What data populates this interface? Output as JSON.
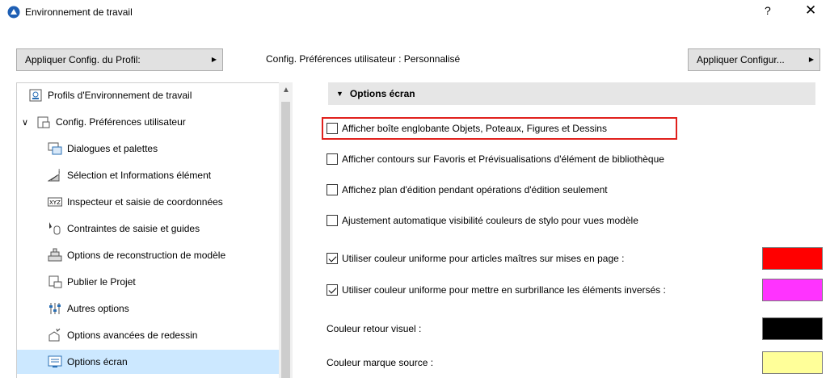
{
  "window": {
    "title": "Environnement de travail",
    "help_label": "?",
    "close_label": "✕"
  },
  "toolbar": {
    "apply_profile_label": "Appliquer Config. du Profil:",
    "config_label": "Config. Préférences utilisateur : Personnalisé",
    "apply_config_label": "Appliquer Configur..."
  },
  "tree": {
    "items": [
      {
        "label": "Profils d'Environnement de travail",
        "icon": "profiles-icon"
      },
      {
        "label": "Config. Préférences utilisateur",
        "icon": "user-prefs-icon",
        "expander": "∨"
      },
      {
        "label": "Dialogues et palettes",
        "icon": "dialogs-icon"
      },
      {
        "label": "Sélection et Informations élément",
        "icon": "selection-info-icon"
      },
      {
        "label": "Inspecteur et saisie de coordonnées",
        "icon": "xyz-icon",
        "icon_text": "XYZ"
      },
      {
        "label": "Contraintes de saisie et guides",
        "icon": "cursor-guide-icon"
      },
      {
        "label": "Options de reconstruction de modèle",
        "icon": "rebuild-icon"
      },
      {
        "label": "Publier le Projet",
        "icon": "publish-icon"
      },
      {
        "label": "Autres options",
        "icon": "sliders-icon"
      },
      {
        "label": "Options avancées de redessin",
        "icon": "redraw-icon"
      },
      {
        "label": "Options écran",
        "icon": "screen-icon",
        "selected": true
      }
    ]
  },
  "panel": {
    "section_title": "Options écran",
    "options": [
      {
        "label": "Afficher boîte englobante Objets, Poteaux, Figures et Dessins",
        "checked": false
      },
      {
        "label": "Afficher contours sur Favoris et Prévisualisations d'élément de bibliothèque",
        "checked": false
      },
      {
        "label": "Affichez plan d'édition pendant opérations d'édition seulement",
        "checked": false
      },
      {
        "label": "Ajustement automatique visibilité couleurs de stylo pour vues modèle",
        "checked": false
      },
      {
        "label": "Utiliser couleur uniforme pour articles maîtres sur mises en page :",
        "checked": true,
        "color": "#ff0000"
      },
      {
        "label": "Utiliser couleur uniforme pour mettre en surbrillance les éléments inversés :",
        "checked": true,
        "color": "#ff33ff"
      }
    ],
    "color_rows": [
      {
        "label": "Couleur retour visuel :",
        "color": "#000000"
      },
      {
        "label": "Couleur marque source :",
        "color": "#ffff99"
      }
    ]
  }
}
